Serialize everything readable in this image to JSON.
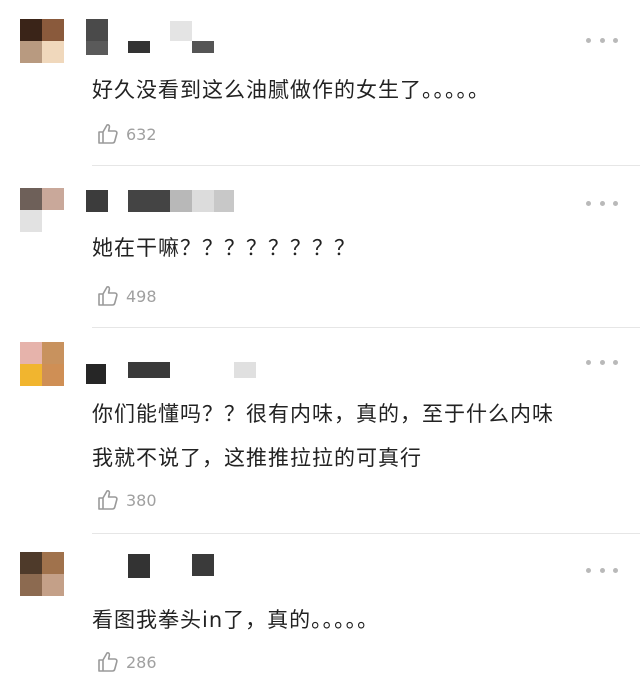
{
  "comments": [
    {
      "text": "好久没看到这么油腻做作的女生了。。。。。",
      "likes": "632",
      "avatar_colors": [
        "#3a2418",
        "#8a5a3c",
        "#b89a80",
        "#f0d8bc"
      ],
      "username_colors": [
        "#4a4a4a",
        "#333333",
        "#e4e4e4",
        "#555555"
      ]
    },
    {
      "text": "她在干嘛？？？？？？？？",
      "likes": "498",
      "avatar_colors": [
        "#6e6059",
        "#c9a89a",
        "#e2e2e2",
        "#ffffff"
      ],
      "username_colors": [
        "#3c3c3c",
        "#444444",
        "#b8b8b8",
        "#dcdcdc",
        "#c8c8c8"
      ]
    },
    {
      "text": "你们能懂吗？？很有内味，真的，至于什么内味\n我就不说了，这推推拉拉的可真行",
      "likes": "380",
      "avatar_colors": [
        "#e6b3ab",
        "#c8925e",
        "#f1b52f",
        "#cf8f55"
      ],
      "username_colors": [
        "#262626",
        "#3a3a3a",
        "#e0e0e0"
      ]
    },
    {
      "text": "看图我拳头in了，真的。。。。。",
      "likes": "286",
      "avatar_colors": [
        "#4e3a2a",
        "#a0724c",
        "#8c6a50",
        "#c4a088"
      ],
      "username_colors": [
        "#333333",
        "#3a3a3a"
      ]
    }
  ]
}
